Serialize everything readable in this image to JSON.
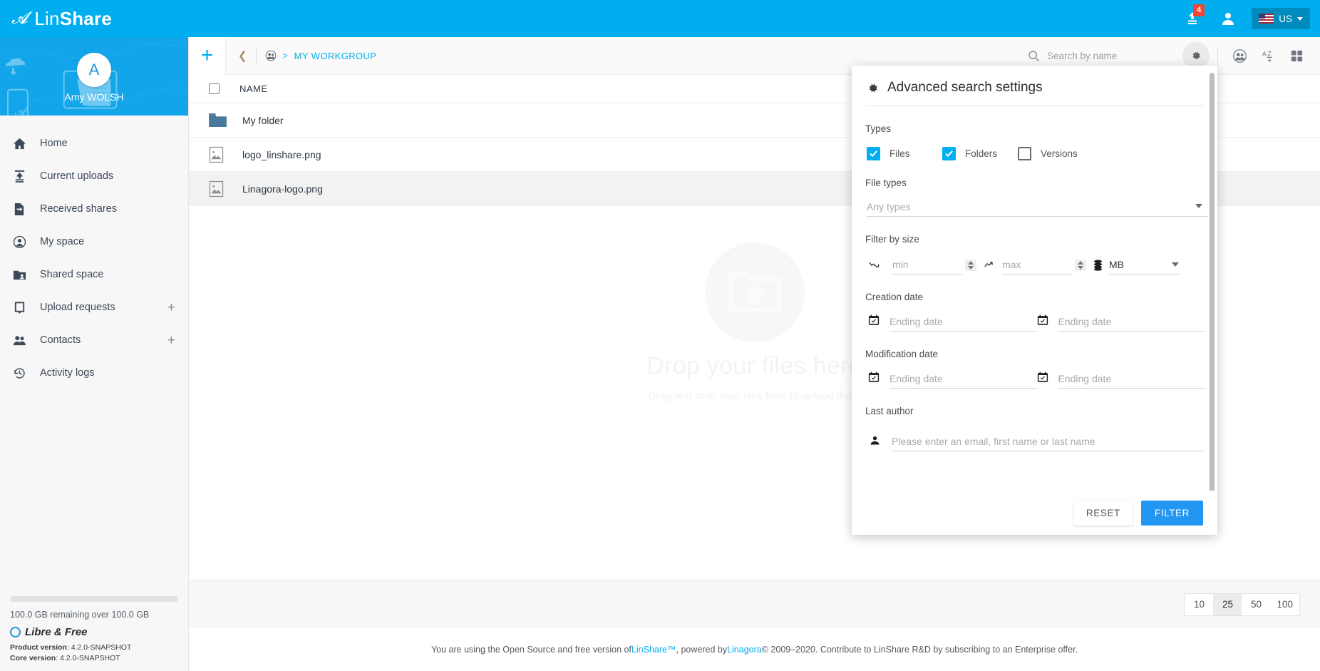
{
  "topbar": {
    "brand_prefix": "Lin",
    "brand_suffix": "Share",
    "upload_badge": "4",
    "language": "US"
  },
  "sidebar": {
    "user": {
      "initial": "A",
      "name": "Amy WOLSH"
    },
    "items": [
      {
        "label": "Home",
        "icon": "home-icon",
        "plus": false
      },
      {
        "label": "Current uploads",
        "icon": "upload-icon",
        "plus": false
      },
      {
        "label": "Received shares",
        "icon": "received-shares-icon",
        "plus": false
      },
      {
        "label": "My space",
        "icon": "person-circle-icon",
        "plus": false
      },
      {
        "label": "Shared space",
        "icon": "shared-space-icon",
        "plus": false
      },
      {
        "label": "Upload requests",
        "icon": "upload-request-icon",
        "plus": true
      },
      {
        "label": "Contacts",
        "icon": "contacts-icon",
        "plus": true
      },
      {
        "label": "Activity logs",
        "icon": "history-icon",
        "plus": false
      }
    ],
    "storage_text": "100.0 GB remaining over 100.0 GB",
    "libre_label": "Libre & Free",
    "product_version_label": "Product version",
    "product_version_value": ": 4.2.0-SNAPSHOT",
    "core_version_label": "Core version",
    "core_version_value": ": 4.2.0-SNAPSHOT"
  },
  "toolbar": {
    "add_label": "+",
    "breadcrumb_current": "MY WORKGROUP",
    "breadcrumb_separator": ">",
    "search_placeholder": "Search by name",
    "search_value": ""
  },
  "list": {
    "columns": [
      "NAME"
    ],
    "rows": [
      {
        "name": "My folder",
        "icon": "folder-icon",
        "selected": false
      },
      {
        "name": "logo_linshare.png",
        "icon": "image-file-icon",
        "selected": false
      },
      {
        "name": "Linagora-logo.png",
        "icon": "image-file-icon",
        "selected": true
      }
    ]
  },
  "dropzone": {
    "title": "Drop your files here",
    "subtitle": "Drag and drop your files here to upload them"
  },
  "pagination": {
    "options": [
      "10",
      "25",
      "50",
      "100"
    ],
    "selected": "25"
  },
  "footer": {
    "part1": "You are using the Open Source and free version of ",
    "link1": "LinShare™",
    "part2": ", powered by ",
    "link2": "Linagora",
    "part3": " © 2009–2020. Contribute to LinShare R&D by subscribing to an Enterprise offer."
  },
  "advanced_search": {
    "title": "Advanced search settings",
    "types_label": "Types",
    "types": [
      {
        "label": "Files",
        "checked": true
      },
      {
        "label": "Folders",
        "checked": true
      },
      {
        "label": "Versions",
        "checked": false
      }
    ],
    "file_types_label": "File types",
    "file_types_placeholder": "Any types",
    "file_types_value": "",
    "size_label": "Filter by size",
    "size_min_placeholder": "min",
    "size_min_value": "",
    "size_max_placeholder": "max",
    "size_max_value": "",
    "size_unit": "MB",
    "creation_date_label": "Creation date",
    "creation_date_from_placeholder": "Ending date",
    "creation_date_to_placeholder": "Ending date",
    "modification_date_label": "Modification date",
    "modification_date_from_placeholder": "Ending date",
    "modification_date_to_placeholder": "Ending date",
    "last_author_label": "Last author",
    "last_author_placeholder": "Please enter an email, first name or last name",
    "reset_label": "RESET",
    "filter_label": "FILTER"
  },
  "colors": {
    "brand_blue": "#00aeef",
    "banner_blue": "#12a5e9",
    "badge_red": "#f2442e",
    "filter_button": "#2196f3"
  }
}
